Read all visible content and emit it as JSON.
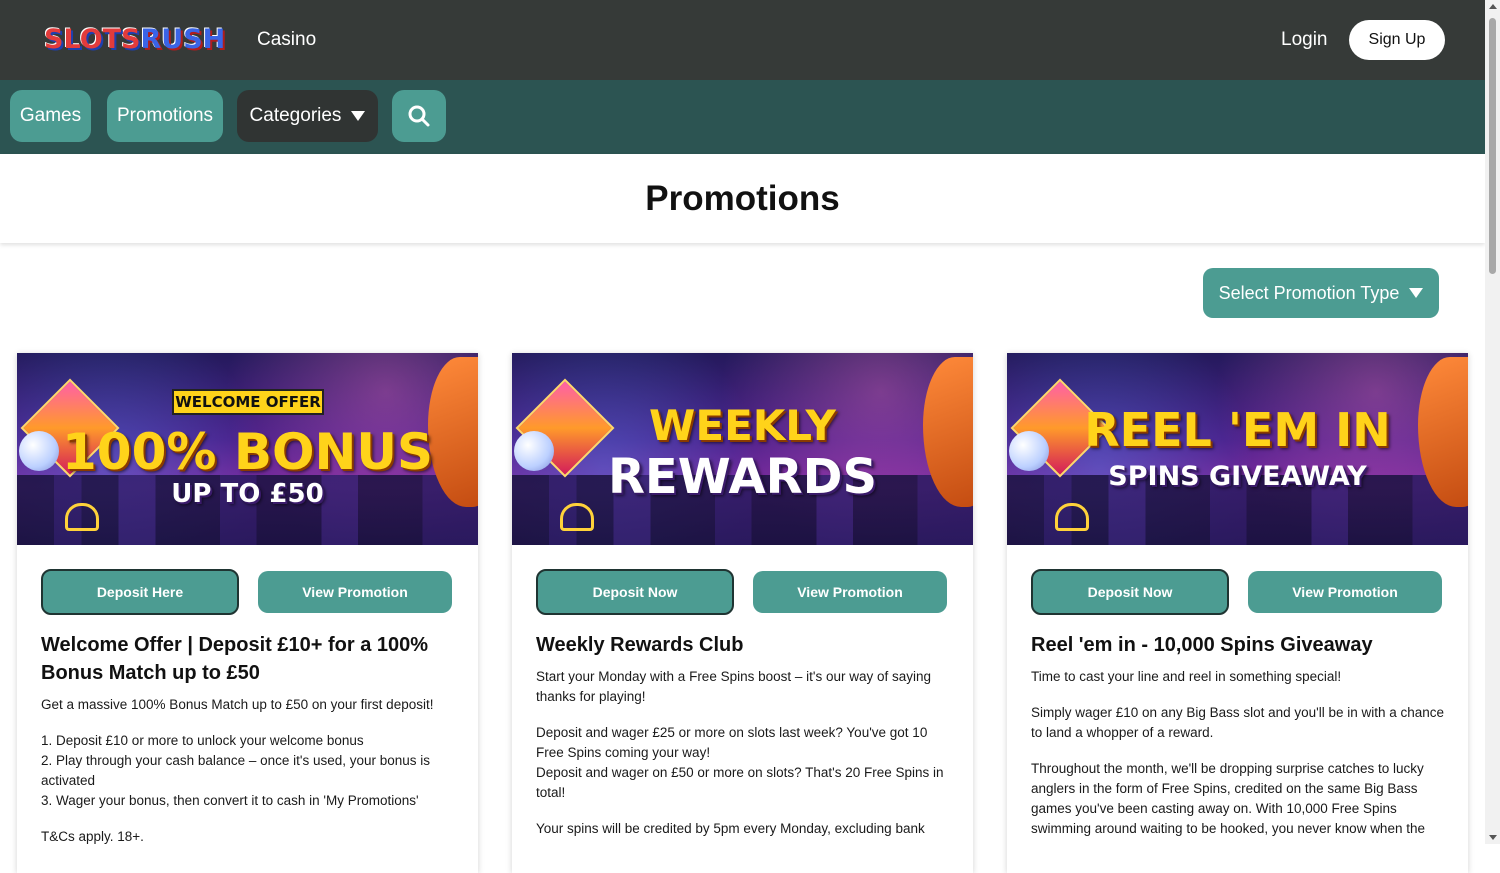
{
  "header": {
    "logo_part1": "SLOTS",
    "logo_part2": "RUSH",
    "casino_label": "Casino",
    "login_label": "Login",
    "signup_label": "Sign Up"
  },
  "nav": {
    "games_label": "Games",
    "promotions_label": "Promotions",
    "categories_label": "Categories"
  },
  "page": {
    "title": "Promotions",
    "select_type_label": "Select Promotion Type"
  },
  "cards": [
    {
      "banner_tag": "WELCOME OFFER",
      "banner_line1": "100% BONUS",
      "banner_line2": "UP TO £50",
      "deposit_label": "Deposit Here",
      "view_label": "View Promotion",
      "title": "Welcome Offer | Deposit £10+ for a 100% Bonus Match up to £50",
      "paragraphs": [
        "Get a massive 100% Bonus Match up to £50 on your first deposit!",
        "1. Deposit £10 or more to unlock your welcome bonus",
        "2. Play through your cash balance – once it's used, your bonus is activated",
        "3. Wager your bonus, then convert it to cash in 'My Promotions'",
        "T&Cs apply. 18+."
      ]
    },
    {
      "banner_line1": "WEEKLY",
      "banner_line2": "REWARDS",
      "deposit_label": "Deposit Now",
      "view_label": "View Promotion",
      "title": "Weekly Rewards Club",
      "paragraphs": [
        "Start your Monday with a Free Spins boost – it's our way of saying thanks for playing!",
        "Deposit and wager £25 or more on slots last week? You've got 10 Free Spins coming your way!",
        "Deposit and wager on £50 or more on slots? That's 20 Free Spins in total!",
        "Your spins will be credited by 5pm every Monday, excluding bank"
      ]
    },
    {
      "banner_line1": "REEL 'EM IN",
      "banner_line2": "SPINS GIVEAWAY",
      "deposit_label": "Deposit Now",
      "view_label": "View Promotion",
      "title": "Reel 'em in - 10,000 Spins Giveaway",
      "paragraphs": [
        "Time to cast your line and reel in something special!",
        "Simply  wager £10 on any Big Bass slot and you'll be in with a chance to land a whopper of a reward.",
        "Throughout the month, we'll be dropping surprise catches to lucky anglers in the form of Free Spins, credited on the same Big Bass games you've been casting away on. With 10,000 Free Spins swimming around waiting to be hooked, you never know when the"
      ]
    }
  ],
  "colors": {
    "topbar": "#363a38",
    "navbar": "#2c5452",
    "accent": "#4c9c92"
  }
}
